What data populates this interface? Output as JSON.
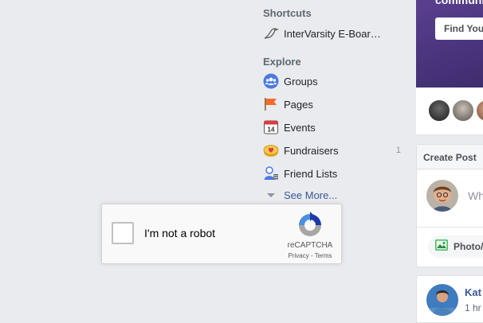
{
  "nav": {
    "shortcuts_heading": "Shortcuts",
    "shortcuts": [
      {
        "label": "InterVarsity E-Boar…",
        "icon": "bird-icon"
      }
    ],
    "explore_heading": "Explore",
    "explore": [
      {
        "label": "Groups",
        "icon": "groups-icon"
      },
      {
        "label": "Pages",
        "icon": "flag-icon"
      },
      {
        "label": "Events",
        "icon": "calendar-icon",
        "calendar_day": "14"
      },
      {
        "label": "Fundraisers",
        "icon": "heart-coin-icon",
        "count": "1"
      },
      {
        "label": "Friend Lists",
        "icon": "friend-list-icon"
      }
    ],
    "see_more": "See More..."
  },
  "captcha": {
    "label": "I'm not a robot",
    "brand": "reCAPTCHA",
    "links": "Privacy - Terms",
    "checked": false
  },
  "promo": {
    "text": "communi",
    "button": "Find Your"
  },
  "create_post": {
    "header": "Create Post",
    "placeholder": "Wh",
    "photo_button": "Photo/"
  },
  "post": {
    "author": "Kat",
    "time": "1 hr"
  },
  "colors": {
    "page_bg": "#e9ebee",
    "link": "#385898",
    "promo_purple": "#4b367c"
  }
}
